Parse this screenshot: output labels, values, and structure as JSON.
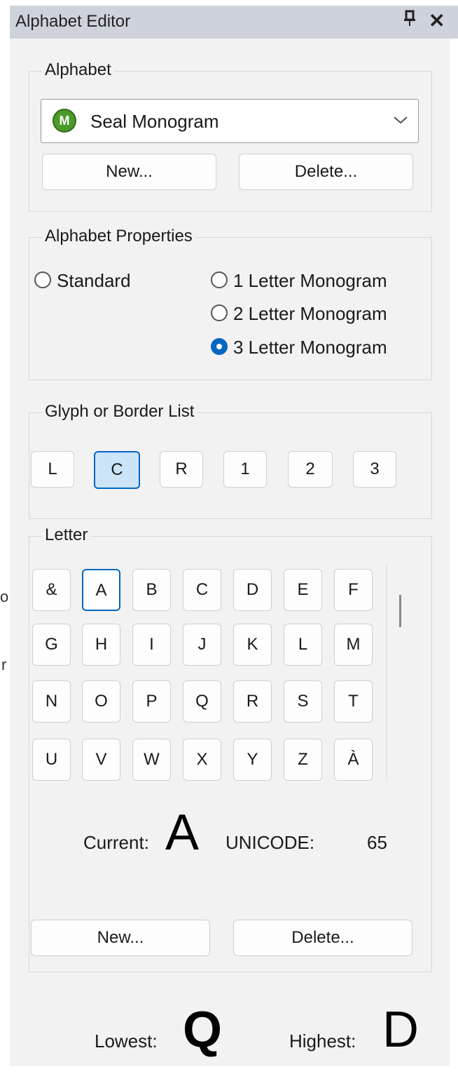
{
  "left_edge_fragments": [
    "o",
    "r"
  ],
  "titlebar": {
    "title": "Alphabet Editor",
    "pin_icon": "pin-icon",
    "close_icon": "close-icon",
    "pin_glyph": "ᵨA",
    "close_glyph": "✕"
  },
  "alphabet_group": {
    "legend": "Alphabet",
    "dropdown": {
      "value": "Seal Monogram",
      "logo_icon": "seal-monogram-logo-icon",
      "chevron_icon": "chevron-down-icon",
      "chevron": "⌵"
    },
    "new_label": "New...",
    "delete_label": "Delete..."
  },
  "properties_group": {
    "legend": "Alphabet Properties",
    "options": [
      "Standard",
      "1 Letter Monogram",
      "2 Letter Monogram",
      "3 Letter Monogram"
    ],
    "selected": "3 Letter Monogram"
  },
  "glyph_group": {
    "legend": "Glyph or Border List",
    "items": [
      "L",
      "C",
      "R",
      "1",
      "2",
      "3"
    ],
    "selected": "C"
  },
  "letter_group": {
    "legend": "Letter",
    "rows": [
      [
        "&",
        "A",
        "B",
        "C",
        "D",
        "E",
        "F"
      ],
      [
        "G",
        "H",
        "I",
        "J",
        "K",
        "L",
        "M"
      ],
      [
        "N",
        "O",
        "P",
        "Q",
        "R",
        "S",
        "T"
      ],
      [
        "U",
        "V",
        "W",
        "X",
        "Y",
        "Z",
        "À"
      ]
    ],
    "current_label": "Current:",
    "current_value": "A",
    "unicode_label": "UNICODE:",
    "unicode_value": "65",
    "new_label": "New...",
    "delete_label": "Delete..."
  },
  "footer": {
    "lowest_label": "Lowest:",
    "lowest_value": "Q",
    "highest_label": "Highest:",
    "highest_value": "D"
  },
  "colors": {
    "titlebar": "#ced3db",
    "panel": "#f2f2f2",
    "accent": "#0067c0",
    "selected_fill": "#cce4f7"
  }
}
